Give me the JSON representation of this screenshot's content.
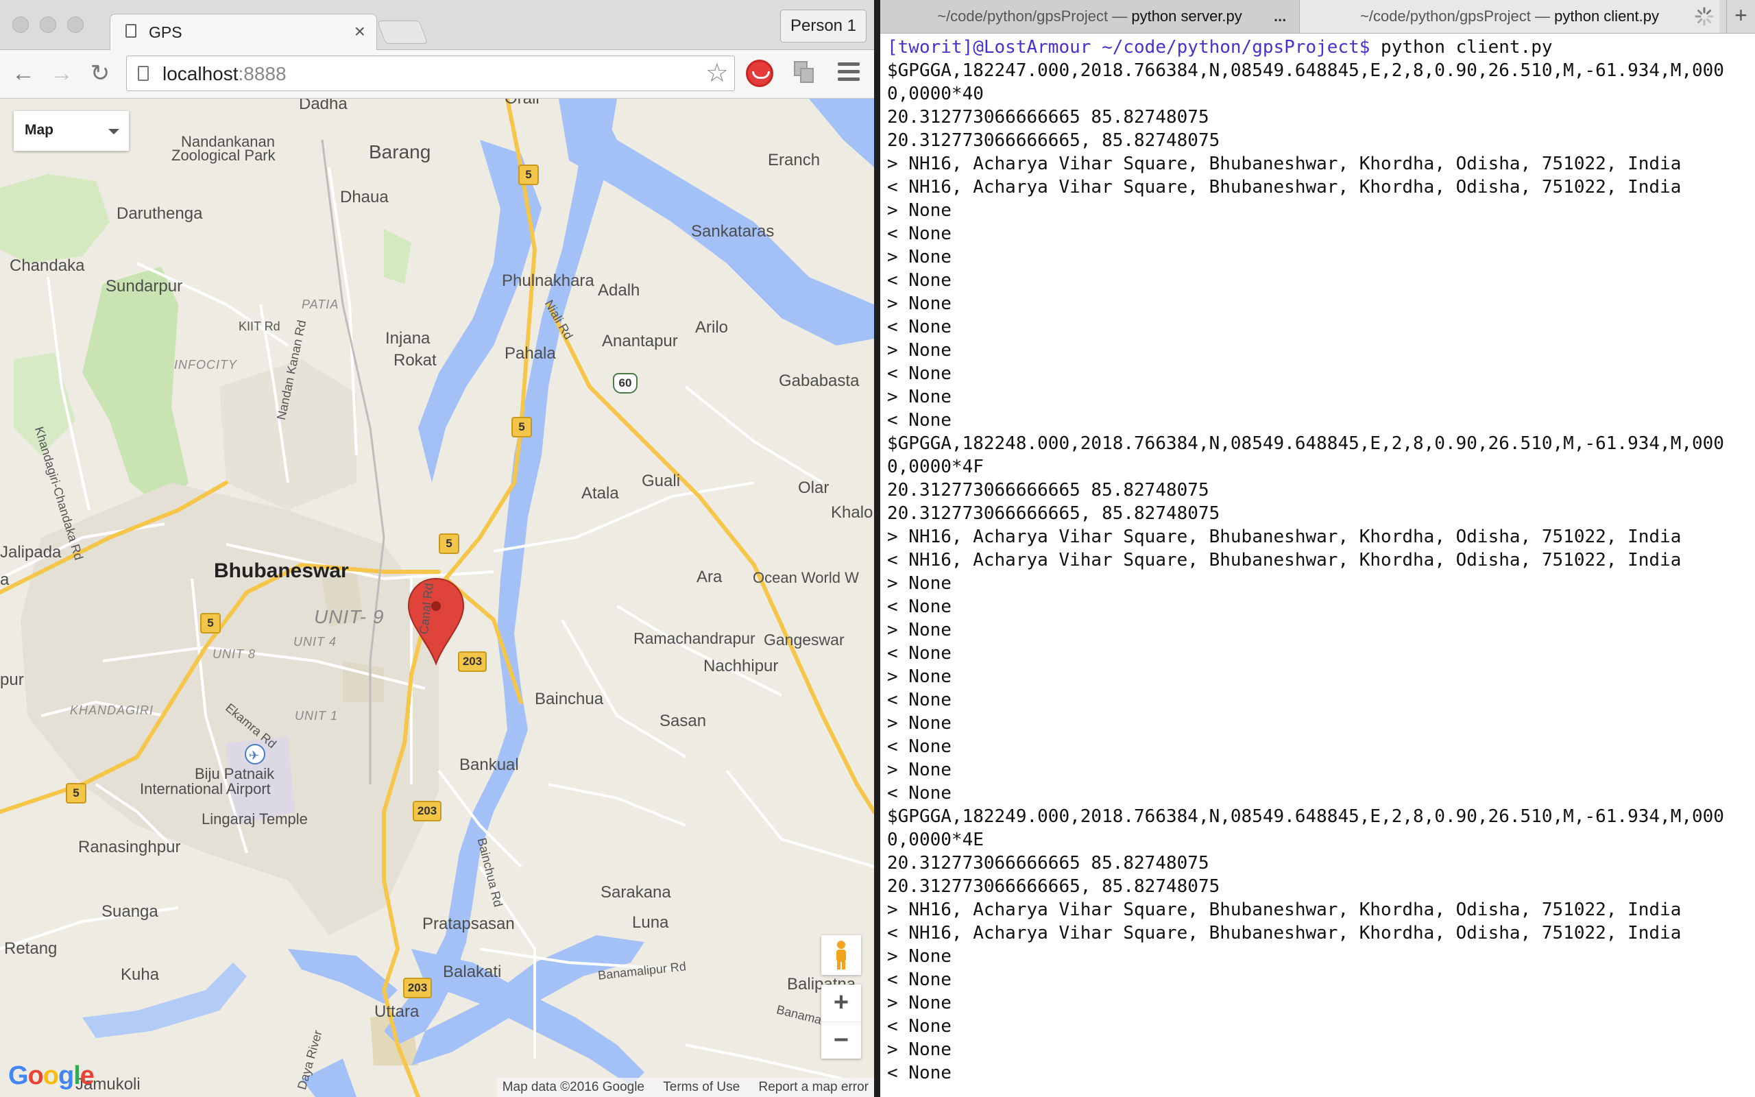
{
  "browser": {
    "tab_title": "GPS",
    "tab_close": "×",
    "profile_button": "Person 1",
    "url_host": "localhost",
    "url_port": ":8888",
    "back": "←",
    "forward": "→",
    "reload": "↻",
    "bookmark_star": "☆"
  },
  "map": {
    "type_control": "Map",
    "zoom_in": "+",
    "zoom_out": "−",
    "google_logo": [
      "G",
      "o",
      "o",
      "g",
      "l",
      "e"
    ],
    "logo_colors": [
      "#4285f4",
      "#ea4335",
      "#fbbc05",
      "#4285f4",
      "#34a853",
      "#ea4335"
    ],
    "attribution": {
      "data": "Map data ©2016 Google",
      "terms": "Terms of Use",
      "report": "Report a map error"
    },
    "colors": {
      "water": "#a3c1f7",
      "park": "#c9e3b2",
      "major_road": "#f5c64a",
      "urban": "#e4e0d6",
      "marker": "#e0433a"
    },
    "labels": {
      "dadha": "Dadha",
      "nandankanan": "Nandankanan",
      "zoo": "Zoological Park",
      "barang": "Barang",
      "orali": "Orali",
      "eranch": "Eranch",
      "daruthenga": "Daruthenga",
      "dhaua": "Dhaua",
      "sankataras": "Sankataras",
      "chandaka": "Chandaka",
      "sundarpur": "Sundarpur",
      "patia": "PATIA",
      "phulnakhara": "Phulnakhara",
      "adalh": "Adalh",
      "kiit_rd": "KIIT Rd",
      "injana": "Injana",
      "rokat": "Rokat",
      "anantapur": "Anantapur",
      "arilo": "Arilo",
      "pahala": "Pahala",
      "infocity": "INFOCITY",
      "gababasta": "Gababasta",
      "khandagiri_chandaka_rd": "Khandagiri-Chandaka Rd",
      "nandan_kanan_rd": "Nandan Kanan Rd",
      "niali_rd": "Niali Rd",
      "atala": "Atala",
      "guali": "Guali",
      "olar": "Olar",
      "khalo": "Khalo",
      "jalipada": "Jalipada",
      "bhubaneswar": "Bhubaneswar",
      "unit9": "UNIT- 9",
      "ara": "Ara",
      "ocean_world": "Ocean World W",
      "canal_rd": "Canal Rd",
      "unit8": "UNIT 8",
      "unit4": "UNIT 4",
      "ramachandrapur": "Ramachandrapur",
      "gangeswar": "Gangeswar",
      "nachhipur": "Nachhipur",
      "pur": "pur",
      "ekamra_rd": "Ekamra Rd",
      "bainchua": "Bainchua",
      "unit1": "UNIT 1",
      "sasan": "Sasan",
      "khandagiri": "KHANDAGIRI",
      "biju_patnaik": "Biju Patnaik",
      "airport": "International Airport",
      "bankual": "Bankual",
      "lingaraj": "Lingaraj Temple",
      "ranasinghpur": "Ranasinghpur",
      "bainchua_rd": "Bainchua Rd",
      "sarakana": "Sarakana",
      "suanga": "Suanga",
      "luna": "Luna",
      "pratapsasan": "Pratapsasan",
      "retang": "Retang",
      "balakati": "Balakati",
      "banamalipur_rd": "Banamalipur Rd",
      "kuha": "Kuha",
      "balipatna": "Balipatna",
      "banama": "Banama",
      "uttara": "Uttara",
      "daya_river": "Daya River",
      "jamukoli": "Jamukoli",
      "a": "a"
    },
    "shields": {
      "five": "5",
      "nh203": "203",
      "nh60": "60"
    }
  },
  "terminal": {
    "tab1_path": "~/code/python/gpsProject — ",
    "tab1_cmd": "python server.py",
    "tab1_more": "...",
    "tab2_path": "~/code/python/gpsProject — ",
    "tab2_cmd": "python client.py",
    "add_tab": "+",
    "prompt": "[tworit]@LostArmour ~/code/python/gpsProject$",
    "command": " python client.py",
    "lines": [
      "$GPGGA,182247.000,2018.766384,N,08549.648845,E,2,8,0.90,26.510,M,-61.934,M,000",
      "0,0000*40",
      "20.312773066666665 85.82748075",
      "20.312773066666665, 85.82748075",
      "> NH16, Acharya Vihar Square, Bhubaneshwar, Khordha, Odisha, 751022, India",
      "< NH16, Acharya Vihar Square, Bhubaneshwar, Khordha, Odisha, 751022, India",
      "> None",
      "< None",
      "> None",
      "< None",
      "> None",
      "< None",
      "> None",
      "< None",
      "> None",
      "< None",
      "$GPGGA,182248.000,2018.766384,N,08549.648845,E,2,8,0.90,26.510,M,-61.934,M,000",
      "0,0000*4F",
      "20.312773066666665 85.82748075",
      "20.312773066666665, 85.82748075",
      "> NH16, Acharya Vihar Square, Bhubaneshwar, Khordha, Odisha, 751022, India",
      "< NH16, Acharya Vihar Square, Bhubaneshwar, Khordha, Odisha, 751022, India",
      "> None",
      "< None",
      "> None",
      "< None",
      "> None",
      "< None",
      "> None",
      "< None",
      "> None",
      "< None",
      "$GPGGA,182249.000,2018.766384,N,08549.648845,E,2,8,0.90,26.510,M,-61.934,M,000",
      "0,0000*4E",
      "20.312773066666665 85.82748075",
      "20.312773066666665, 85.82748075",
      "> NH16, Acharya Vihar Square, Bhubaneshwar, Khordha, Odisha, 751022, India",
      "< NH16, Acharya Vihar Square, Bhubaneshwar, Khordha, Odisha, 751022, India",
      "> None",
      "< None",
      "> None",
      "< None",
      "> None",
      "< None"
    ]
  }
}
